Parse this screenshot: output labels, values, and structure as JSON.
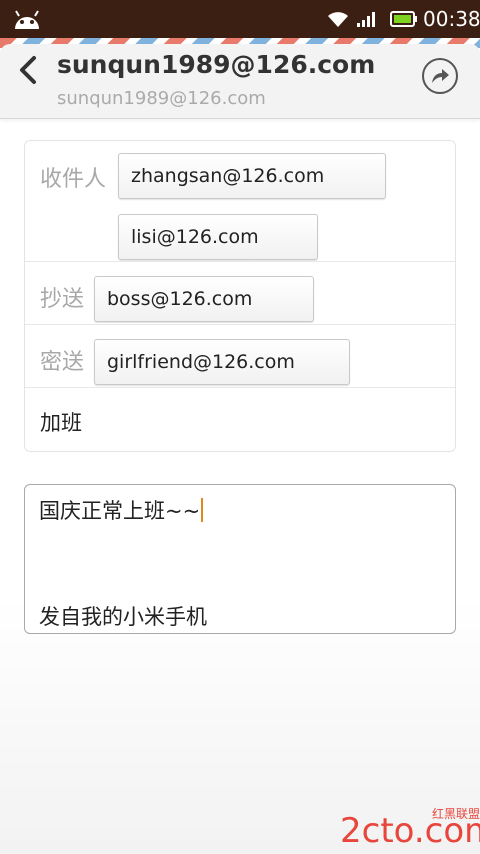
{
  "status_bar": {
    "time": "00:38",
    "icons": [
      "android-icon",
      "wifi-icon",
      "signal-icon",
      "battery-icon"
    ]
  },
  "header": {
    "title": "sunqun1989@126.com",
    "subtitle": "sunqun1989@126.com",
    "back_icon": "back-icon",
    "forward_icon": "forward-icon"
  },
  "recipients": {
    "to_label": "收件人",
    "to": [
      "zhangsan@126.com",
      "lisi@126.com"
    ],
    "cc_label": "抄送",
    "cc": [
      "boss@126.com"
    ],
    "bcc_label": "密送",
    "bcc": [
      "girlfriend@126.com"
    ],
    "subject": "加班"
  },
  "body": {
    "text": "国庆正常上班~~",
    "signature": "发自我的小米手机"
  },
  "watermark": {
    "logo": "2cto.com",
    "tagline": "红黑联盟"
  },
  "colors": {
    "status_bar": "#3a1f12",
    "header_bg": "#f3f3f3",
    "label_gray": "#a8a8a8",
    "cursor": "#e08a1e",
    "watermark_red": "#e8463c",
    "airmail_red": "#e87a6c",
    "airmail_blue": "#7fb3de"
  }
}
